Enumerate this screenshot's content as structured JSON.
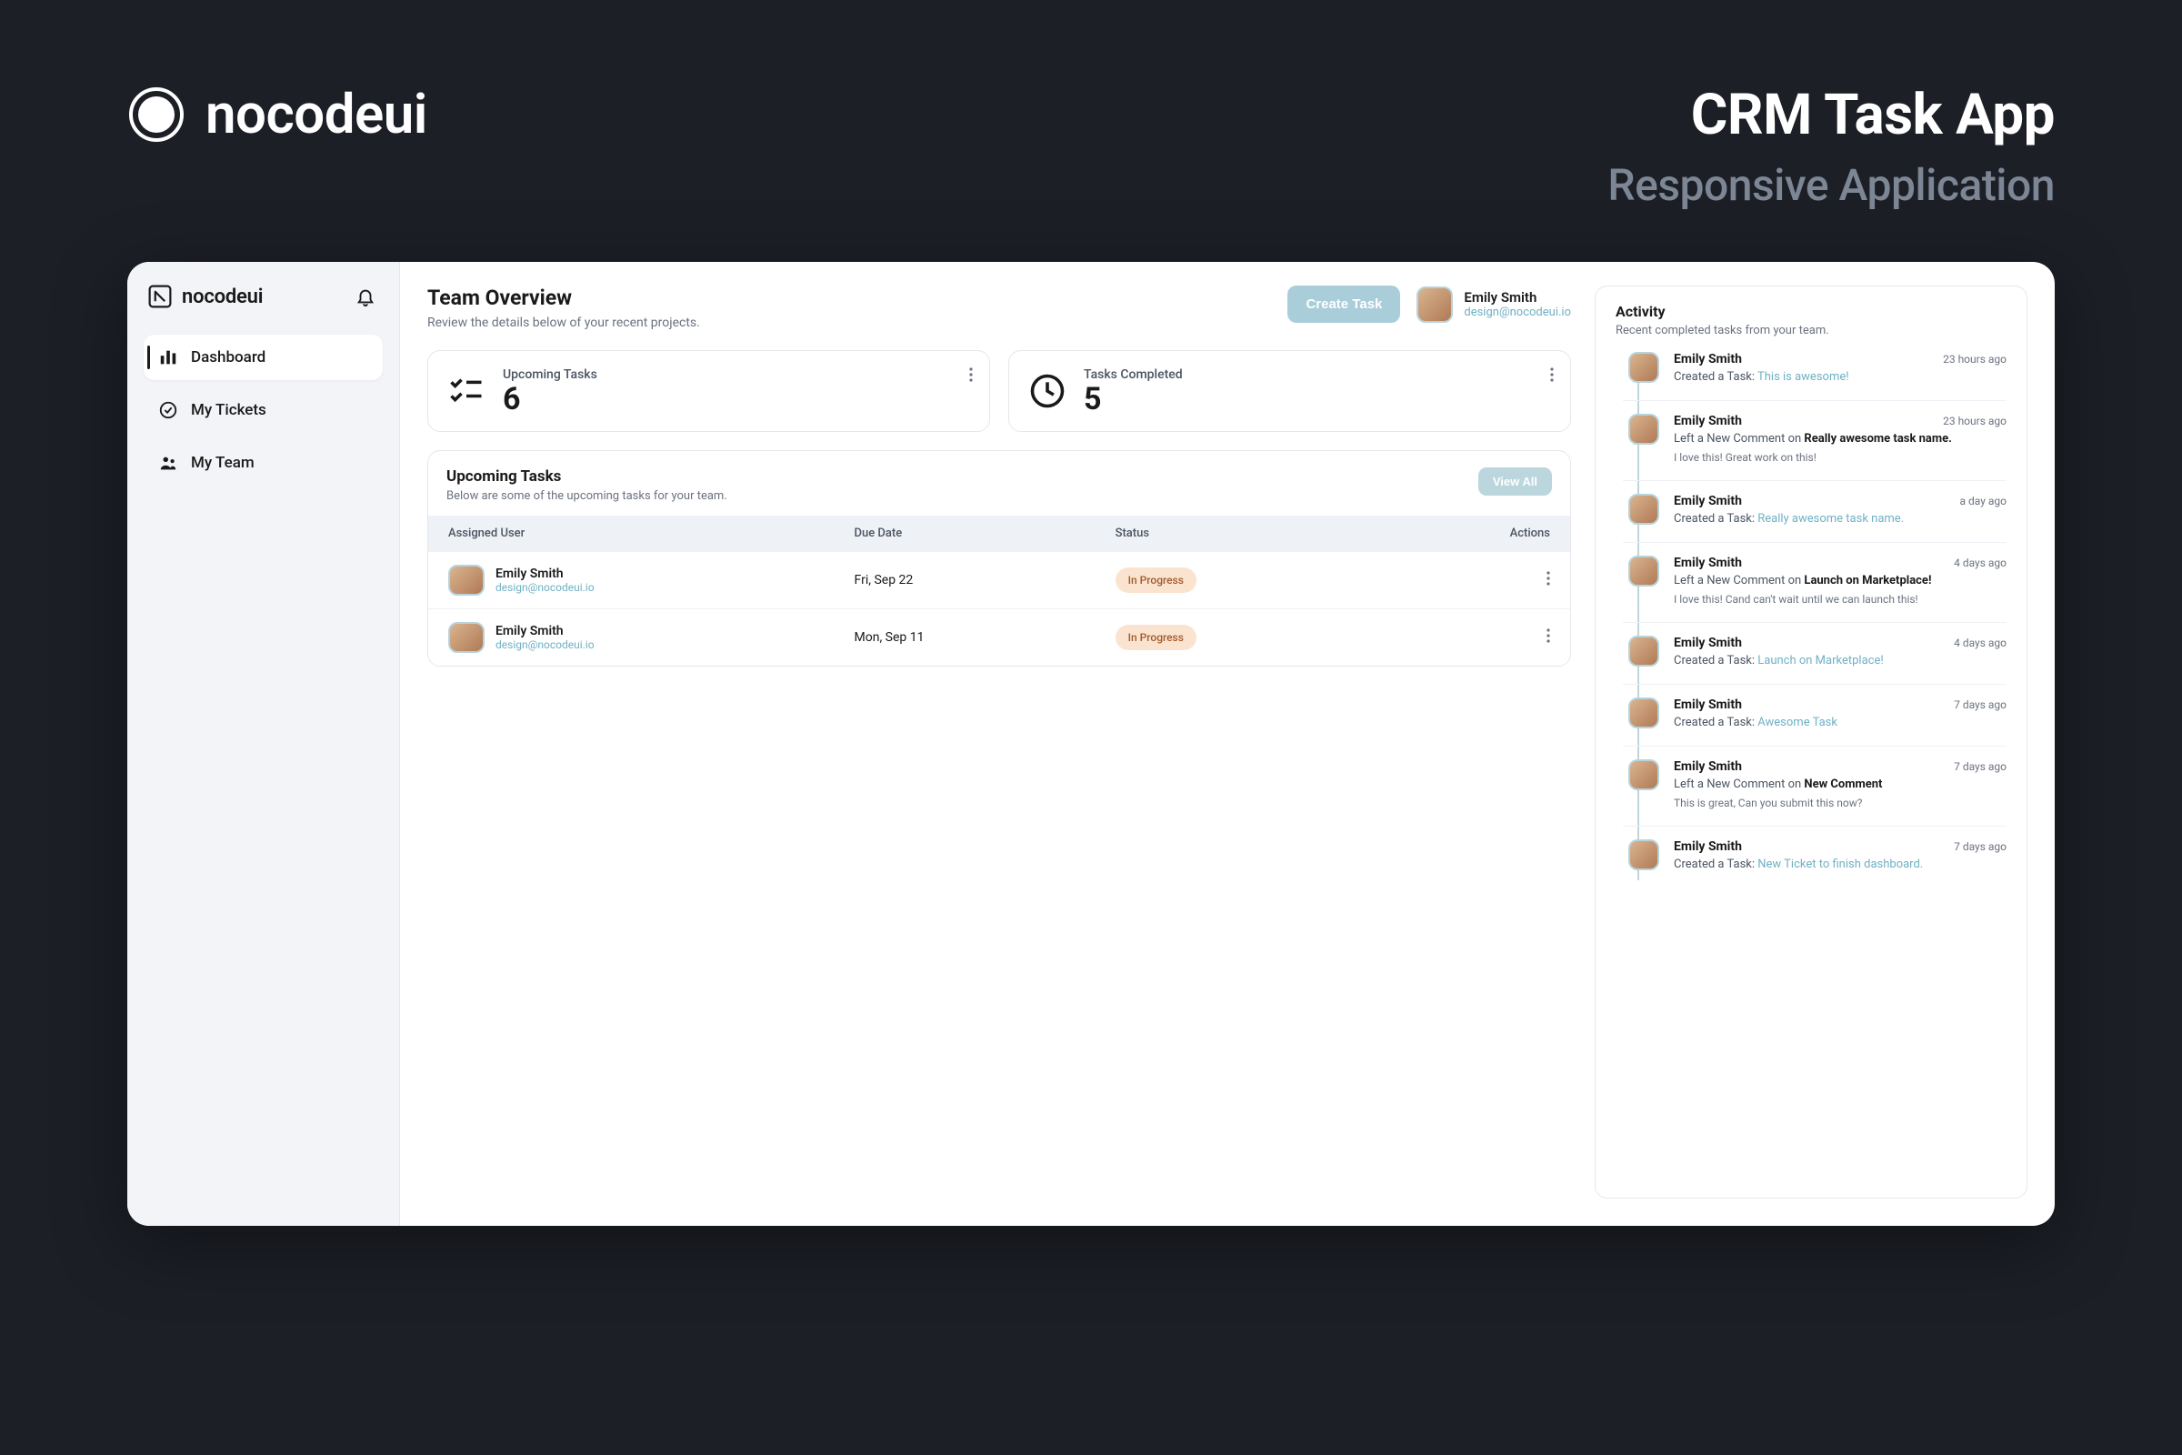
{
  "hero": {
    "brand": "nocodeui",
    "title": "CRM Task App",
    "subtitle": "Responsive Application"
  },
  "sidebar": {
    "brand": "nocodeui",
    "nav": [
      {
        "label": "Dashboard",
        "active": true
      },
      {
        "label": "My Tickets",
        "active": false
      },
      {
        "label": "My Team",
        "active": false
      }
    ]
  },
  "header": {
    "title": "Team Overview",
    "subtitle": "Review the details below of your recent projects.",
    "create_task_label": "Create Task",
    "user": {
      "name": "Emily Smith",
      "email": "design@nocodeui.io"
    }
  },
  "stats": {
    "upcoming": {
      "label": "Upcoming Tasks",
      "value": "6"
    },
    "completed": {
      "label": "Tasks Completed",
      "value": "5"
    }
  },
  "tasks_panel": {
    "title": "Upcoming Tasks",
    "subtitle": "Below are some of the upcoming tasks for your team.",
    "view_all_label": "View All",
    "columns": {
      "user": "Assigned User",
      "due": "Due Date",
      "status": "Status",
      "actions": "Actions"
    },
    "rows": [
      {
        "name": "Emily Smith",
        "email": "design@nocodeui.io",
        "due": "Fri, Sep 22",
        "status": "In Progress"
      },
      {
        "name": "Emily Smith",
        "email": "design@nocodeui.io",
        "due": "Mon, Sep 11",
        "status": "In Progress"
      }
    ]
  },
  "activity": {
    "title": "Activity",
    "subtitle": "Recent completed tasks from your team.",
    "items": [
      {
        "name": "Emily Smith",
        "time": "23 hours ago",
        "prefix": "Created a Task: ",
        "link": "This is awesome!",
        "link_class": "link"
      },
      {
        "name": "Emily Smith",
        "time": "23 hours ago",
        "prefix": "Left a New Comment on ",
        "link": "Really awesome task name.",
        "link_class": "bold",
        "note": "I love this! Great work on this!"
      },
      {
        "name": "Emily Smith",
        "time": "a day ago",
        "prefix": "Created a Task: ",
        "link": "Really awesome task name.",
        "link_class": "link"
      },
      {
        "name": "Emily Smith",
        "time": "4 days ago",
        "prefix": "Left a New Comment on ",
        "link": "Launch on Marketplace!",
        "link_class": "bold",
        "note": "I love this! Cand can't wait until we can launch this!"
      },
      {
        "name": "Emily Smith",
        "time": "4 days ago",
        "prefix": "Created a Task: ",
        "link": "Launch on Marketplace!",
        "link_class": "link"
      },
      {
        "name": "Emily Smith",
        "time": "7 days ago",
        "prefix": "Created a Task: ",
        "link": "Awesome Task",
        "link_class": "link"
      },
      {
        "name": "Emily Smith",
        "time": "7 days ago",
        "prefix": "Left a New Comment on ",
        "link": "New Comment",
        "link_class": "bold",
        "note": "This is great, Can you submit this now?"
      },
      {
        "name": "Emily Smith",
        "time": "7 days ago",
        "prefix": "Created a Task: ",
        "link": "New Ticket to finish dashboard.",
        "link_class": "link"
      }
    ]
  }
}
